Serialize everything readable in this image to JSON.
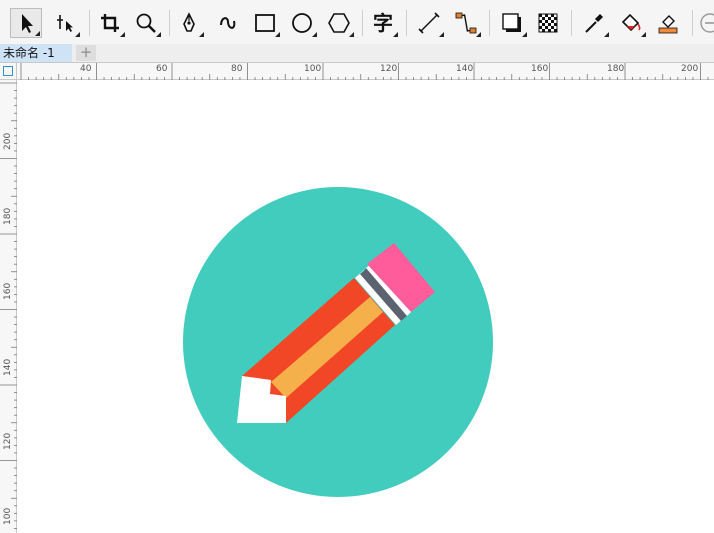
{
  "toolbar": {
    "tools": [
      {
        "name": "pick-tool",
        "icon": "arrow-pointer-icon",
        "active": true
      },
      {
        "name": "shape-tool",
        "icon": "node-edit-icon"
      },
      {
        "name": "crop-tool",
        "icon": "crop-icon"
      },
      {
        "name": "zoom-tool",
        "icon": "magnifier-icon"
      },
      {
        "name": "freehand-tool",
        "icon": "pen-nib-icon"
      },
      {
        "name": "artistic-media-tool",
        "icon": "curve-icon"
      },
      {
        "name": "rectangle-tool",
        "icon": "rectangle-icon"
      },
      {
        "name": "ellipse-tool",
        "icon": "ellipse-icon"
      },
      {
        "name": "polygon-tool",
        "icon": "hexagon-icon"
      },
      {
        "name": "text-tool",
        "icon": "text-char-icon",
        "glyph": "字"
      },
      {
        "name": "parallel-dimension-tool",
        "icon": "dimension-line-icon"
      },
      {
        "name": "connector-tool",
        "icon": "connector-icon"
      },
      {
        "name": "drop-shadow-tool",
        "icon": "drop-shadow-icon"
      },
      {
        "name": "transparency-tool",
        "icon": "checkerboard-icon"
      },
      {
        "name": "eyedropper-tool",
        "icon": "eyedropper-icon"
      },
      {
        "name": "interactive-fill-tool",
        "icon": "paint-bucket-icon"
      },
      {
        "name": "smart-fill-tool",
        "icon": "smart-fill-icon"
      },
      {
        "name": "add-tool-button",
        "icon": "plus-circle-icon"
      }
    ]
  },
  "tabs": {
    "document": "未命名 -1",
    "add_label": "+"
  },
  "ruler": {
    "horizontal_labels": [
      "40",
      "60",
      "80",
      "100",
      "120",
      "140",
      "160",
      "180",
      "200"
    ],
    "vertical_labels": [
      "200",
      "180",
      "160",
      "140",
      "120",
      "100"
    ]
  },
  "artwork": {
    "circle_color": "#42ccbd",
    "pencil_body_color": "#f24726",
    "pencil_center_color": "#f6b04b",
    "eraser_color": "#ff5c9c",
    "band_color": "#5b6270",
    "tip_color": "#ffffff"
  }
}
